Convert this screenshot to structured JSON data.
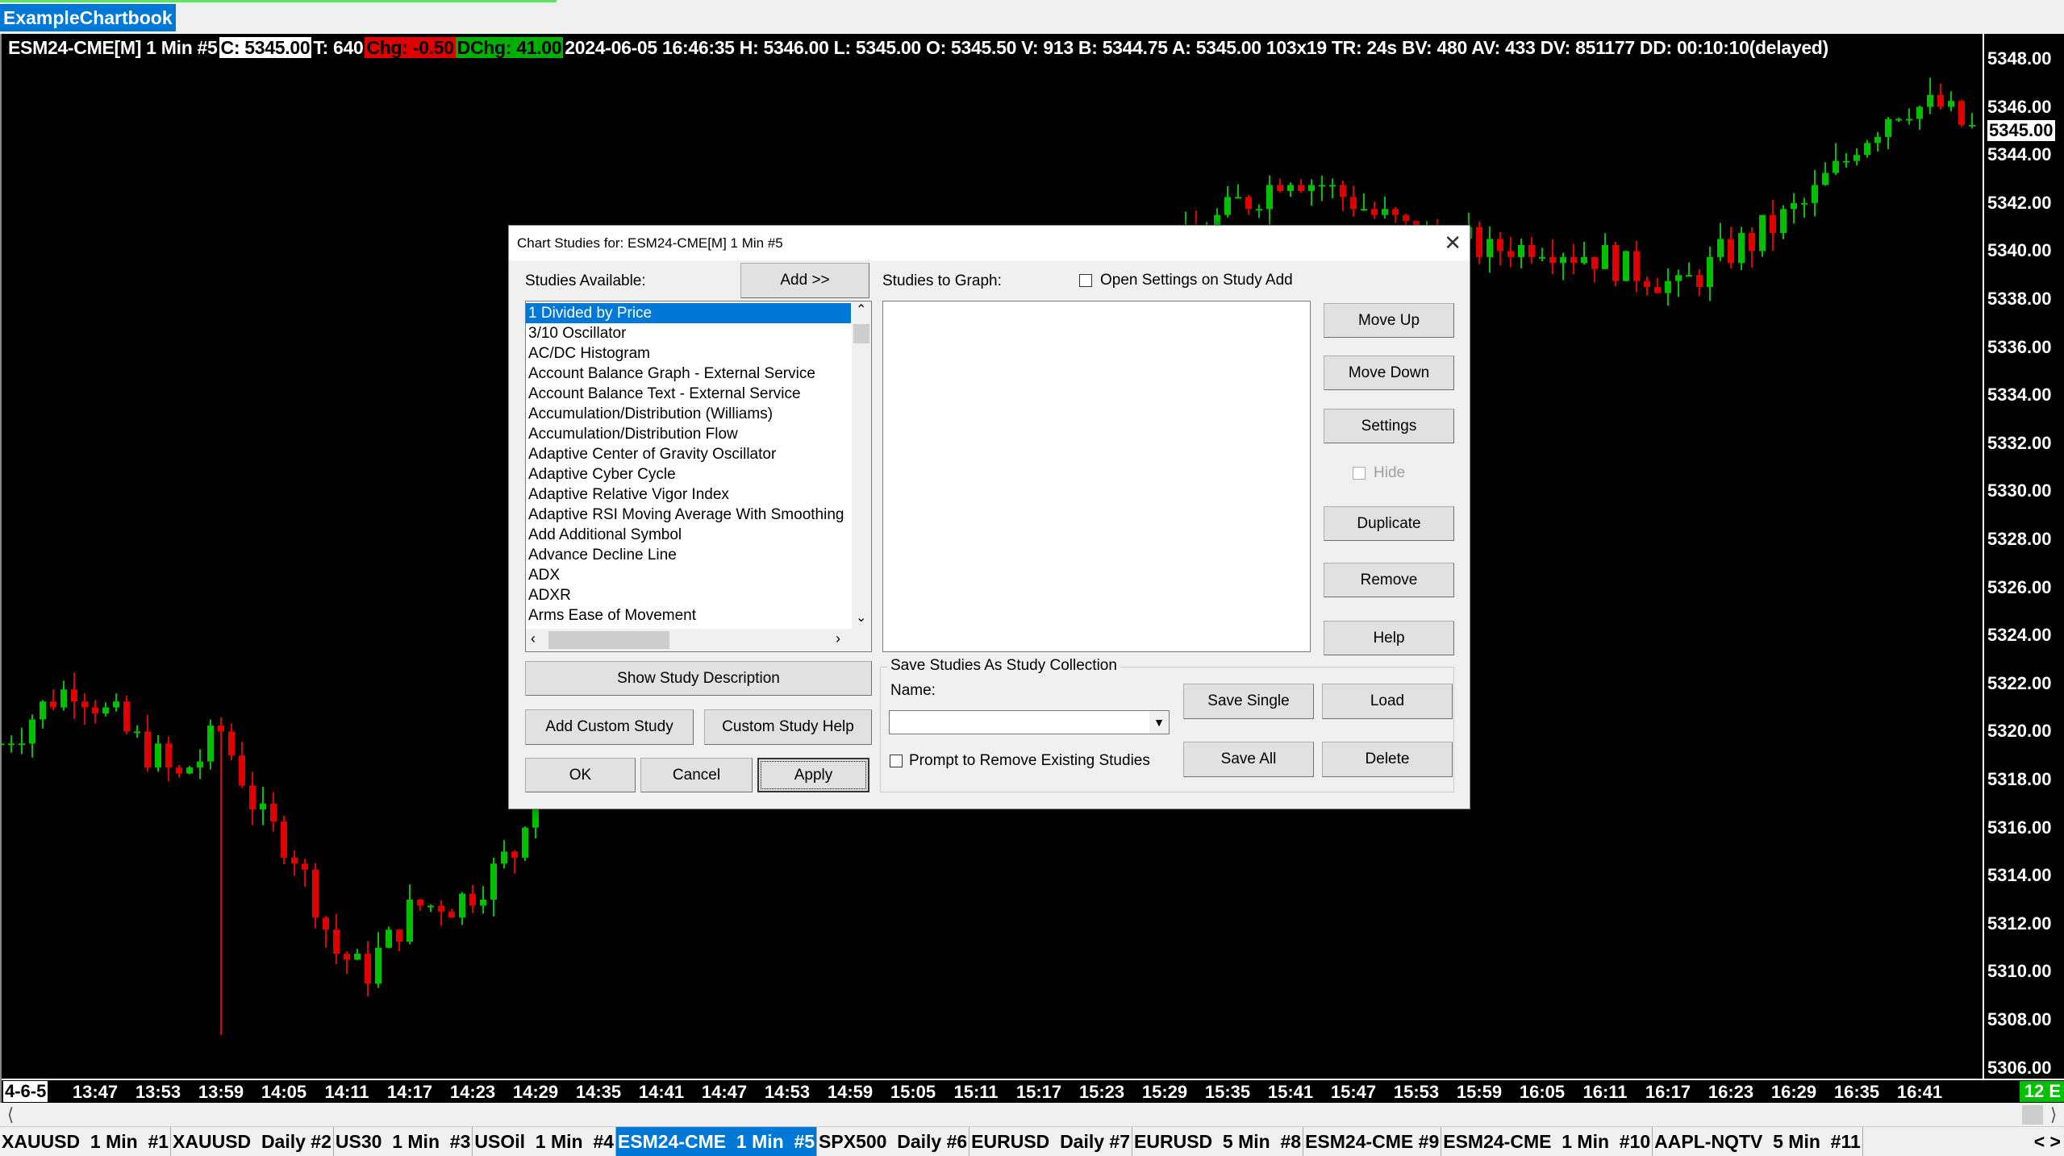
{
  "window": {
    "chartbook_tab": "ExampleChartbook"
  },
  "info": {
    "symbol": "ESM24-CME[M]  1 Min  #5",
    "close": "C: 5345.00",
    "trades": "T: 640",
    "change": "Chg: -0.50",
    "daily_change": "DChg: 41.00",
    "rest": "2024-06-05 16:46:35 H: 5346.00 L: 5345.00 O: 5345.50 V: 913 B: 5344.75 A: 5345.00 103x19 TR: 24s BV: 480 AV: 433 DV: 851177 DD: 00:10:10(delayed)"
  },
  "colors": {
    "up": "#00c000",
    "down": "#e00000",
    "selection": "#0078d7",
    "background": "#000000"
  },
  "price_axis": {
    "labels": [
      "5348.00",
      "5346.00",
      "5344.00",
      "5342.00",
      "5340.00",
      "5338.00",
      "5336.00",
      "5334.00",
      "5332.00",
      "5330.00",
      "5328.00",
      "5326.00",
      "5324.00",
      "5322.00",
      "5320.00",
      "5318.00",
      "5316.00",
      "5314.00",
      "5312.00",
      "5310.00",
      "5308.00",
      "5306.00"
    ],
    "current": "5345.00"
  },
  "time_axis": {
    "date": "4-6-5",
    "labels": [
      "13:47",
      "13:53",
      "13:59",
      "14:05",
      "14:11",
      "14:17",
      "14:23",
      "14:29",
      "14:35",
      "14:41",
      "14:47",
      "14:53",
      "14:59",
      "15:05",
      "15:11",
      "15:17",
      "15:23",
      "15:29",
      "15:35",
      "15:41",
      "15:47",
      "15:53",
      "15:59",
      "16:05",
      "16:11",
      "16:17",
      "16:23",
      "16:29",
      "16:35",
      "16:41"
    ],
    "badge": "12 E"
  },
  "chart_data": {
    "type": "candlestick",
    "price_path": [
      [
        "13:38",
        5319.5
      ],
      [
        "13:45",
        5322
      ],
      [
        "13:50",
        5320
      ],
      [
        "13:55",
        5318
      ],
      [
        "13:59",
        5320
      ],
      [
        "14:03",
        5316.2
      ],
      [
        "14:06",
        5315
      ],
      [
        "14:10",
        5310.8
      ],
      [
        "14:13",
        5310
      ],
      [
        "14:17",
        5312.6
      ],
      [
        "14:22",
        5313
      ],
      [
        "14:27",
        5315
      ],
      [
        "14:30",
        5320
      ],
      [
        "14:33",
        5322
      ],
      [
        "15:00",
        5330
      ],
      [
        "15:25",
        5338
      ],
      [
        "15:35",
        5341.7
      ],
      [
        "15:41",
        5343.3
      ],
      [
        "15:45",
        5342.5
      ],
      [
        "15:50",
        5341.4
      ],
      [
        "15:52",
        5340.8
      ],
      [
        "16:00",
        5340
      ],
      [
        "16:05",
        5340.3
      ],
      [
        "16:10",
        5339.8
      ],
      [
        "16:15",
        5339
      ],
      [
        "16:18",
        5338.4
      ],
      [
        "16:22",
        5339.8
      ],
      [
        "16:25",
        5340.5
      ],
      [
        "16:30",
        5342
      ],
      [
        "16:33",
        5343.3
      ],
      [
        "16:36",
        5345
      ],
      [
        "16:39",
        5346
      ],
      [
        "16:43",
        5346
      ],
      [
        "16:46",
        5345
      ]
    ]
  },
  "dialog": {
    "title": "Chart Studies for: ESM24-CME[M]  1 Min  #5",
    "studies_available_label": "Studies Available:",
    "add_label": "Add >>",
    "studies_to_graph_label": "Studies to Graph:",
    "open_settings_label": "Open Settings on Study Add",
    "studies": [
      "1 Divided by Price",
      "3/10 Oscillator",
      "AC/DC Histogram",
      "Account Balance Graph - External Service",
      "Account Balance Text - External Service",
      "Accumulation/Distribution (Williams)",
      "Accumulation/Distribution Flow",
      "Adaptive Center of Gravity Oscillator",
      "Adaptive Cyber Cycle",
      "Adaptive Relative Vigor Index",
      "Adaptive RSI Moving Average With Smoothing",
      "Add Additional Symbol",
      "Advance Decline Line",
      "ADX",
      "ADXR",
      "Arms Ease of Movement"
    ],
    "buttons": {
      "move_up": "Move Up",
      "move_down": "Move Down",
      "settings": "Settings",
      "hide": "Hide",
      "duplicate": "Duplicate",
      "remove": "Remove",
      "help": "Help",
      "show_desc": "Show Study Description",
      "add_custom": "Add Custom Study",
      "custom_help": "Custom Study Help",
      "ok": "OK",
      "cancel": "Cancel",
      "apply": "Apply",
      "save_single": "Save Single",
      "load": "Load",
      "save_all": "Save All",
      "delete": "Delete"
    },
    "collection": {
      "group_label": "Save Studies As Study Collection",
      "name_label": "Name:",
      "name_value": "",
      "prompt_label": "Prompt to Remove Existing Studies"
    }
  },
  "tabs": [
    {
      "label": "XAUUSD  1 Min  #1"
    },
    {
      "label": "XAUUSD  Daily #2"
    },
    {
      "label": "US30  1 Min  #3"
    },
    {
      "label": "USOil  1 Min  #4"
    },
    {
      "label": "ESM24-CME  1 Min  #5",
      "active": true
    },
    {
      "label": "SPX500  Daily #6"
    },
    {
      "label": "EURUSD  Daily #7"
    },
    {
      "label": "EURUSD  5 Min  #8"
    },
    {
      "label": "ESM24-CME #9"
    },
    {
      "label": "ESM24-CME  1 Min  #10"
    },
    {
      "label": "AAPL-NQTV  5 Min  #11"
    }
  ],
  "tab_nav": "< >"
}
